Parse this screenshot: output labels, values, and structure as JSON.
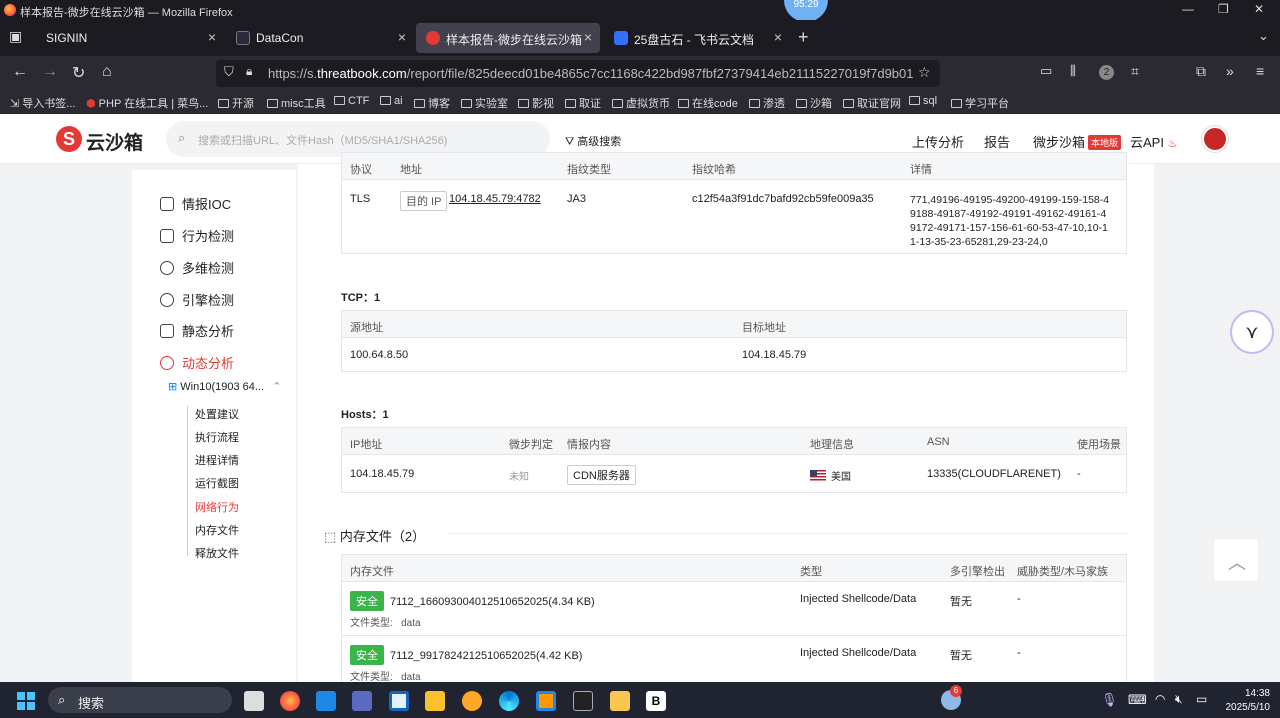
{
  "window": {
    "title": "样本报告-微步在线云沙箱 — Mozilla Firefox",
    "timer": "95:29"
  },
  "tabs": [
    {
      "label": "SIGNIN"
    },
    {
      "label": "DataCon"
    },
    {
      "label": "样本报告-微步在线云沙箱"
    },
    {
      "label": "25盘古石 - 飞书云文档"
    }
  ],
  "nav": {
    "url_prefix": "https://s.",
    "url_host": "threatbook.com",
    "url_path": "/report/file/825deecd01be4865c7cc1168c422bd987fbf27379414eb21115227019f7d9b01",
    "ext_count": "2"
  },
  "bookmarks": [
    "导入书签...",
    "PHP 在线工具 | 菜鸟...",
    "开源",
    "misc工具",
    "CTF",
    "ai",
    "博客",
    "实验室",
    "影视",
    "取证",
    "虚拟货币",
    "在线code",
    "渗透",
    "沙箱",
    "取证官网",
    "sql",
    "学习平台"
  ],
  "header": {
    "logo": "云沙箱",
    "search_placeholder": "搜索或扫描URL、文件Hash（MD5/SHA1/SHA256)",
    "advanced": "高级搜索",
    "upload": "上传分析",
    "report": "报告",
    "local": "微步沙箱",
    "local_badge": "本地版",
    "api": "云API"
  },
  "sidebar": {
    "items": [
      "情报IOC",
      "行为检测",
      "多维检测",
      "引擎检测",
      "静态分析",
      "动态分析"
    ],
    "env": "Win10(1903 64...",
    "subitems": [
      "处置建议",
      "执行流程",
      "进程详情",
      "运行截图",
      "网络行为",
      "内存文件",
      "释放文件"
    ]
  },
  "tls_table": {
    "headers": [
      "协议",
      "地址",
      "指纹类型",
      "指纹哈希",
      "详情"
    ],
    "row": {
      "protocol": "TLS",
      "tag": "目的 IP",
      "address": "104.18.45.79:4782",
      "fp_type": "JA3",
      "fp_hash": "c12f54a3f91dc7bafd92cb59fe009a35",
      "detail_lines": [
        "771,49196-49195-49200-49199-159-158-4",
        "9188-49187-49192-49191-49162-49161-4",
        "9172-49171-157-156-61-60-53-47-10,10-1",
        "1-13-35-23-65281,29-23-24,0"
      ]
    }
  },
  "tcp": {
    "title": "TCP：1",
    "headers": [
      "源地址",
      "目标地址"
    ],
    "row": [
      "100.64.8.50",
      "104.18.45.79"
    ]
  },
  "hosts": {
    "title": "Hosts：1",
    "headers": [
      "IP地址",
      "微步判定",
      "情报内容",
      "地理信息",
      "ASN",
      "使用场景"
    ],
    "row": {
      "ip": "104.18.45.79",
      "verdict": "未知",
      "intel": "CDN服务器",
      "geo": "美国",
      "asn": "13335(CLOUDFLARENET)",
      "scene": "-"
    }
  },
  "memfiles": {
    "title": "内存文件（2）",
    "headers": [
      "内存文件",
      "类型",
      "多引擎检出",
      "威胁类型/木马家族"
    ],
    "rows": [
      {
        "badge": "安全",
        "name": "7112_1660930040125106520​25(4.34 KB)",
        "ftype_label": "文件类型:",
        "ftype": "data",
        "type": "Injected Shellcode/Data",
        "engine": "暂无",
        "threat": "-"
      },
      {
        "badge": "安全",
        "name": "7112_9917824212510652025(4.42 KB)",
        "ftype_label": "文件类型:",
        "ftype": "data",
        "type": "Injected Shellcode/Data",
        "engine": "暂无",
        "threat": "-"
      }
    ]
  },
  "taskbar": {
    "search": "搜索",
    "weather_badge": "6",
    "time": "14:38",
    "date": "2025/5/10"
  }
}
